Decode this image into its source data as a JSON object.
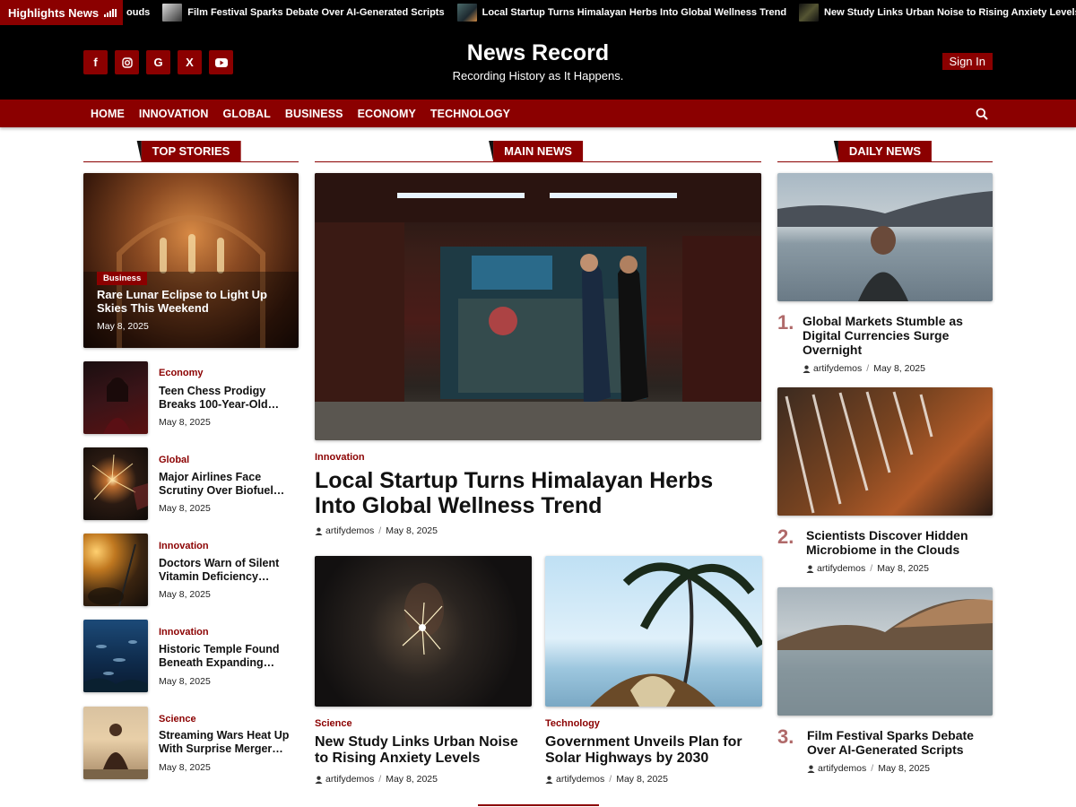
{
  "ticker": {
    "label": "Highlights News",
    "items": [
      {
        "text": "ouds"
      },
      {
        "text": "Film Festival Sparks Debate Over AI-Generated Scripts"
      },
      {
        "text": "Local Startup Turns Himalayan Herbs Into Global Wellness Trend"
      },
      {
        "text": "New Study Links Urban Noise to Rising Anxiety Levels"
      }
    ]
  },
  "header": {
    "site_title": "News Record",
    "tagline": "Recording History as It Happens.",
    "signin_label": "Sign In",
    "socials": [
      {
        "icon": "facebook-icon",
        "glyph": "f"
      },
      {
        "icon": "instagram-icon",
        "glyph": "◎"
      },
      {
        "icon": "google-icon",
        "glyph": "G"
      },
      {
        "icon": "x-icon",
        "glyph": "X"
      },
      {
        "icon": "youtube-icon",
        "glyph": "▶"
      }
    ]
  },
  "nav": {
    "items": [
      "HOME",
      "INNOVATION",
      "GLOBAL",
      "BUSINESS",
      "ECONOMY",
      "TECHNOLOGY"
    ]
  },
  "sections": {
    "top_stories": "TOP STORIES",
    "main_news": "MAIN NEWS",
    "daily_news": "DAILY NEWS"
  },
  "top_story": {
    "category": "Business",
    "title": "Rare Lunar Eclipse to Light Up Skies This Weekend",
    "date": "May 8, 2025"
  },
  "top_list": [
    {
      "category": "Economy",
      "title": "Teen Chess Prodigy Breaks 100-Year-Old…",
      "date": "May 8, 2025"
    },
    {
      "category": "Global",
      "title": "Major Airlines Face Scrutiny Over Biofuel…",
      "date": "May 8, 2025"
    },
    {
      "category": "Innovation",
      "title": "Doctors Warn of Silent Vitamin Deficiency…",
      "date": "May 8, 2025"
    },
    {
      "category": "Innovation",
      "title": "Historic Temple Found Beneath Expanding…",
      "date": "May 8, 2025"
    },
    {
      "category": "Science",
      "title": "Streaming Wars Heat Up With Surprise Merger…",
      "date": "May 8, 2025"
    }
  ],
  "main_news": {
    "category": "Innovation",
    "title": "Local Startup Turns Himalayan Herbs Into Global Wellness Trend",
    "author": "artifydemos",
    "date": "May 8, 2025",
    "sub": [
      {
        "category": "Science",
        "title": "New Study Links Urban Noise to Rising Anxiety Levels",
        "author": "artifydemos",
        "date": "May 8, 2025"
      },
      {
        "category": "Technology",
        "title": "Government Unveils Plan for Solar Highways by 2030",
        "author": "artifydemos",
        "date": "May 8, 2025"
      }
    ]
  },
  "daily_news": [
    {
      "rank": "1.",
      "title": "Global Markets Stumble as Digital Currencies Surge Overnight",
      "author": "artifydemos",
      "date": "May 8, 2025"
    },
    {
      "rank": "2.",
      "title": "Scientists Discover Hidden Microbiome in the Clouds",
      "author": "artifydemos",
      "date": "May 8, 2025"
    },
    {
      "rank": "3.",
      "title": "Film Festival Sparks Debate Over AI-Generated Scripts",
      "author": "artifydemos",
      "date": "May 8, 2025"
    }
  ],
  "colors": {
    "accent": "#8b0000",
    "header_bg": "#000000"
  }
}
